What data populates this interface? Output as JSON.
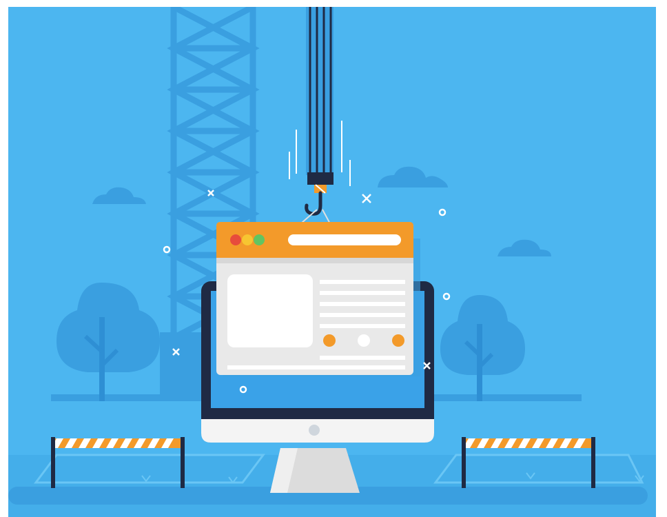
{
  "illustration": {
    "subject": "website-under-construction",
    "icons": [
      "crane-icon",
      "crane-hook-icon",
      "browser-window-icon",
      "desktop-monitor-icon",
      "tree-icon",
      "cloud-icon",
      "barrier-icon"
    ],
    "colors": {
      "sky": "#4cb6f0",
      "accent_blue": "#3a9fe0",
      "dark_blue": "#2e8fd4",
      "orange": "#f39a2a",
      "navy": "#1f2a44",
      "white": "#ffffff",
      "light_gray": "#e6e6e6"
    }
  }
}
